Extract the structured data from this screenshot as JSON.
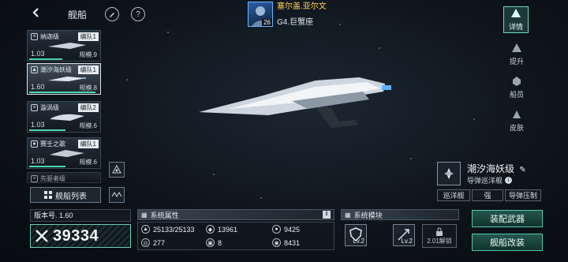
{
  "header": {
    "title": "舰船",
    "captain_name": "塞尔盖.亚尔文",
    "captain_level": "26",
    "captain_location": "G4.巨蟹座"
  },
  "ship_list": [
    {
      "name": "纳迦级",
      "group": "编队1",
      "version": "1.03",
      "spec": "规模.9",
      "progress": 0.45,
      "selected": false
    },
    {
      "name": "潮汐海妖级",
      "group": "编队1",
      "version": "1.60",
      "spec": "规模.8",
      "progress": 0.9,
      "selected": true
    },
    {
      "name": "漩涡级",
      "group": "编队2",
      "version": "1.03",
      "spec": "规模.6",
      "progress": 0.5,
      "selected": false
    },
    {
      "name": "赛壬之歌",
      "group": "编队1",
      "version": "1.03",
      "spec": "规模.6",
      "progress": 0.5,
      "selected": false
    },
    {
      "name": "先驱者级",
      "group": "",
      "version": "",
      "spec": "",
      "progress": 0,
      "selected": false
    }
  ],
  "ship_list_button": "舰船列表",
  "nav": [
    {
      "label": "详情",
      "icon": "detail-icon",
      "active": true
    },
    {
      "label": "提升",
      "icon": "upgrade-icon",
      "active": false
    },
    {
      "label": "船员",
      "icon": "crew-icon",
      "active": false
    },
    {
      "label": "皮肤",
      "icon": "skin-icon",
      "active": false
    }
  ],
  "ship_info": {
    "name": "潮汐海妖级",
    "class": "导弹巡洋舰",
    "tags": [
      "巡洋舰",
      "强",
      "导弹压制"
    ]
  },
  "version_label": "版本号. 1.60",
  "combat_power": "39334",
  "attributes": {
    "title": "系统属性",
    "items": [
      {
        "icon": "hull-icon",
        "value": "25133/25133"
      },
      {
        "icon": "armor-icon",
        "value": "13961"
      },
      {
        "icon": "shield-icon",
        "value": "9425"
      },
      {
        "icon": "speed-icon",
        "value": "277"
      },
      {
        "icon": "grid-icon",
        "value": "8"
      },
      {
        "icon": "energy-icon",
        "value": "8431"
      }
    ]
  },
  "modules": {
    "title": "系统模块",
    "items": [
      {
        "icon": "shield-module-icon",
        "level": "Lv.2"
      },
      {
        "icon": "missile-module-icon",
        "level": "Lv.2"
      }
    ],
    "locked_label": "2.01解锁"
  },
  "actions": {
    "equip": "装配武器",
    "modify": "舰船改装"
  },
  "colors": {
    "accent": "#4fc7a9",
    "captain_name": "#ffd35a"
  }
}
